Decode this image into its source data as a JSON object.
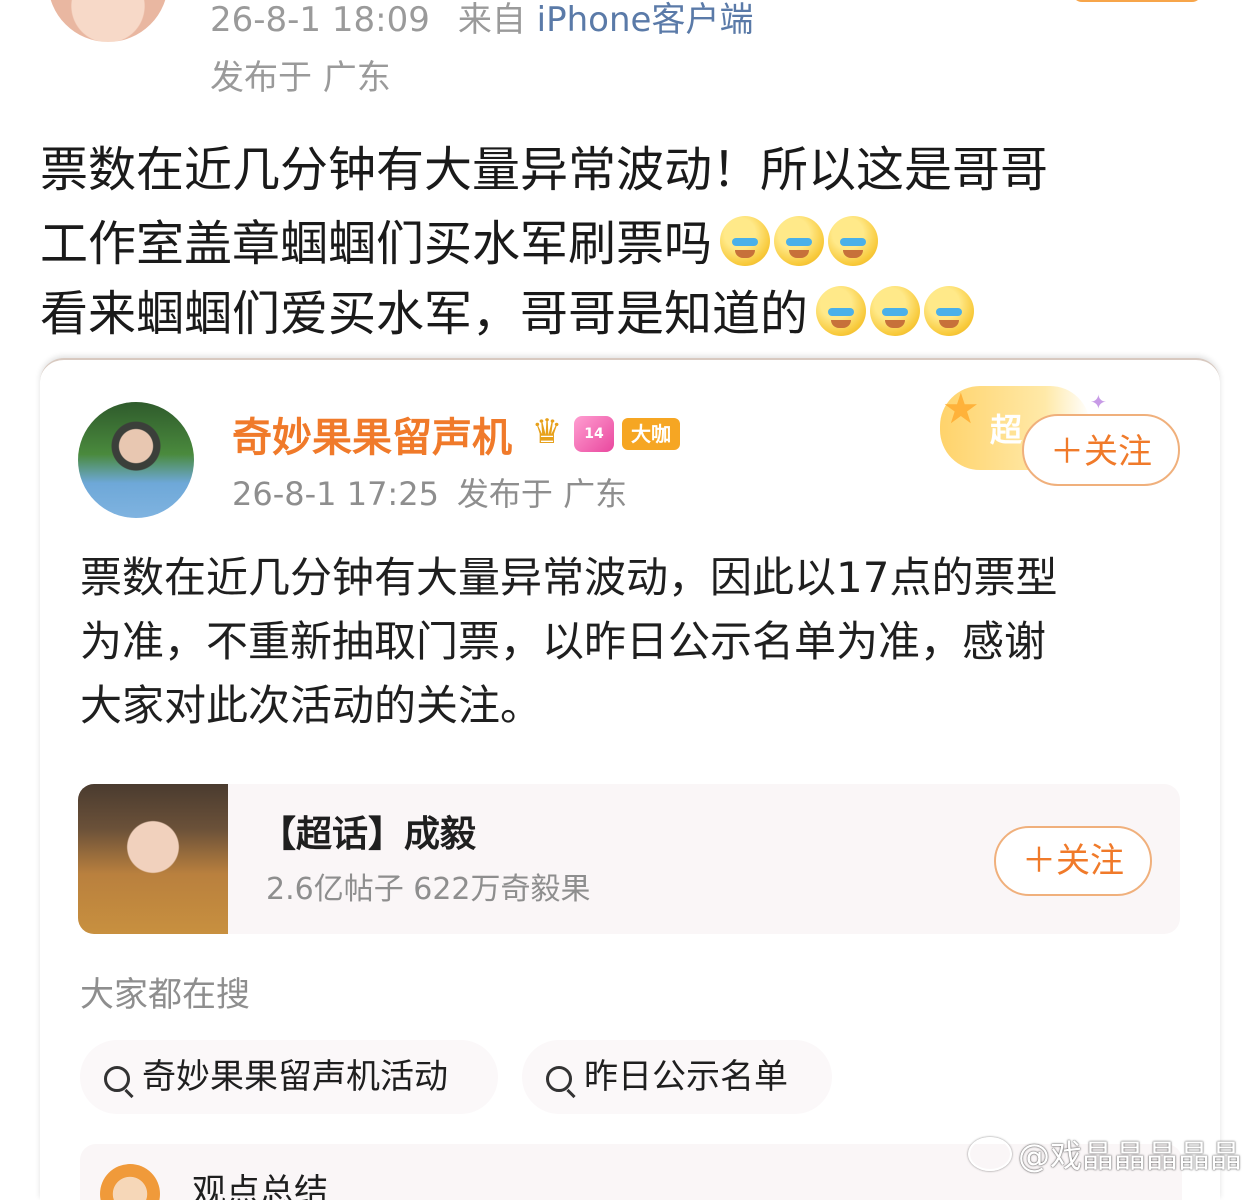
{
  "outer_post": {
    "timestamp": "26-8-1 18:09",
    "source_prefix": "来自",
    "source_client": "iPhone客户端",
    "location": "发布于 广东",
    "lines": [
      "票数在近几分钟有大量异常波动！所以这是哥哥",
      "工作室盖章蝈蝈们买水军刷票吗",
      "看来蝈蝈们爱买水军，哥哥是知道的"
    ]
  },
  "quoted_card": {
    "username": "奇妙果果留声机",
    "badge_level": "14",
    "badge_daka": "大咖",
    "timestamp": "26-8-1 17:25",
    "location": "发布于 广东",
    "super_label": "超",
    "follow_label": "＋关注",
    "body_lines": [
      "票数在近几分钟有大量异常波动，因此以17点的票型",
      "为准，不重新抽取门票，以昨日公示名单为准，感谢",
      "大家对此次活动的关注。"
    ],
    "topic": {
      "title": "【超话】成毅",
      "stats": "2.6亿帖子 622万奇毅果",
      "follow_label": "＋关注"
    },
    "search": {
      "heading": "大家都在搜",
      "chips": [
        "奇妙果果留声机活动",
        "昨日公示名单"
      ]
    },
    "bottom_partial": "观点总结"
  },
  "watermark": "@戏晶晶晶晶晶"
}
